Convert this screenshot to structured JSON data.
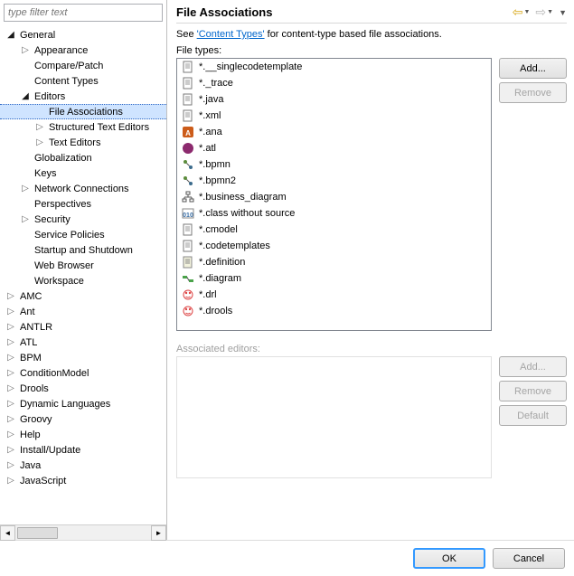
{
  "filter_placeholder": "type filter text",
  "sidebar": {
    "tree": [
      {
        "label": "General",
        "depth": 0,
        "arrow": "expanded"
      },
      {
        "label": "Appearance",
        "depth": 1,
        "arrow": "collapsed"
      },
      {
        "label": "Compare/Patch",
        "depth": 1,
        "arrow": "none"
      },
      {
        "label": "Content Types",
        "depth": 1,
        "arrow": "none"
      },
      {
        "label": "Editors",
        "depth": 1,
        "arrow": "expanded"
      },
      {
        "label": "File Associations",
        "depth": 2,
        "arrow": "none",
        "selected": true
      },
      {
        "label": "Structured Text Editors",
        "depth": 2,
        "arrow": "collapsed"
      },
      {
        "label": "Text Editors",
        "depth": 2,
        "arrow": "collapsed"
      },
      {
        "label": "Globalization",
        "depth": 1,
        "arrow": "none"
      },
      {
        "label": "Keys",
        "depth": 1,
        "arrow": "none"
      },
      {
        "label": "Network Connections",
        "depth": 1,
        "arrow": "collapsed"
      },
      {
        "label": "Perspectives",
        "depth": 1,
        "arrow": "none"
      },
      {
        "label": "Security",
        "depth": 1,
        "arrow": "collapsed"
      },
      {
        "label": "Service Policies",
        "depth": 1,
        "arrow": "none"
      },
      {
        "label": "Startup and Shutdown",
        "depth": 1,
        "arrow": "none"
      },
      {
        "label": "Web Browser",
        "depth": 1,
        "arrow": "none"
      },
      {
        "label": "Workspace",
        "depth": 1,
        "arrow": "none"
      },
      {
        "label": "AMC",
        "depth": 0,
        "arrow": "collapsed"
      },
      {
        "label": "Ant",
        "depth": 0,
        "arrow": "collapsed"
      },
      {
        "label": "ANTLR",
        "depth": 0,
        "arrow": "collapsed"
      },
      {
        "label": "ATL",
        "depth": 0,
        "arrow": "collapsed"
      },
      {
        "label": "BPM",
        "depth": 0,
        "arrow": "collapsed"
      },
      {
        "label": "ConditionModel",
        "depth": 0,
        "arrow": "collapsed"
      },
      {
        "label": "Drools",
        "depth": 0,
        "arrow": "collapsed"
      },
      {
        "label": "Dynamic Languages",
        "depth": 0,
        "arrow": "collapsed"
      },
      {
        "label": "Groovy",
        "depth": 0,
        "arrow": "collapsed"
      },
      {
        "label": "Help",
        "depth": 0,
        "arrow": "collapsed"
      },
      {
        "label": "Install/Update",
        "depth": 0,
        "arrow": "collapsed"
      },
      {
        "label": "Java",
        "depth": 0,
        "arrow": "collapsed"
      },
      {
        "label": "JavaScript",
        "depth": 0,
        "arrow": "collapsed"
      }
    ]
  },
  "main": {
    "title": "File Associations",
    "description_prefix": "See ",
    "content_types_link": "'Content Types'",
    "description_suffix": " for content-type based file associations.",
    "file_types_label": "File types:",
    "file_types": [
      {
        "icon": "text",
        "label": "*.__singlecodetemplate"
      },
      {
        "icon": "text",
        "label": "*._trace"
      },
      {
        "icon": "text",
        "label": "*.java"
      },
      {
        "icon": "text",
        "label": "*.xml"
      },
      {
        "icon": "ana",
        "label": "*.ana"
      },
      {
        "icon": "atl",
        "label": "*.atl"
      },
      {
        "icon": "bpmn",
        "label": "*.bpmn"
      },
      {
        "icon": "bpmn",
        "label": "*.bpmn2"
      },
      {
        "icon": "tree",
        "label": "*.business_diagram"
      },
      {
        "icon": "class",
        "label": "*.class without source"
      },
      {
        "icon": "text",
        "label": "*.cmodel"
      },
      {
        "icon": "text",
        "label": "*.codetemplates"
      },
      {
        "icon": "def",
        "label": "*.definition"
      },
      {
        "icon": "diagram",
        "label": "*.diagram"
      },
      {
        "icon": "drl",
        "label": "*.drl"
      },
      {
        "icon": "drl",
        "label": "*.drools"
      }
    ],
    "associated_editors_label": "Associated editors:",
    "buttons": {
      "add_filetype": "Add...",
      "remove_filetype": "Remove",
      "add_editor": "Add...",
      "remove_editor": "Remove",
      "default_editor": "Default"
    }
  },
  "footer": {
    "ok": "OK",
    "cancel": "Cancel"
  }
}
